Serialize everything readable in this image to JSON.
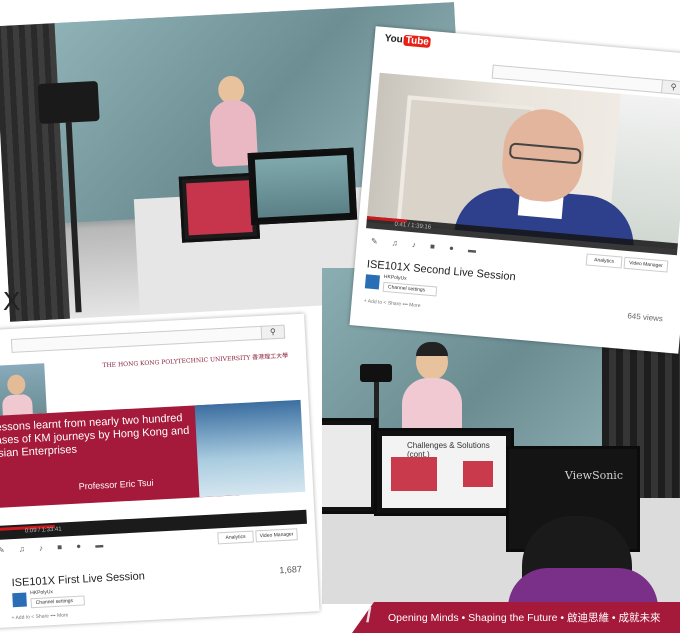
{
  "stray_text": "X",
  "second_session": {
    "logo_text": "You",
    "logo_badge": "Tube",
    "search_icon": "search-icon",
    "video_time": "0:41 / 1:39:16",
    "btn_analytics": "Analytics",
    "btn_video_manager": "Video Manager",
    "title": "ISE101X Second Live Session",
    "channel": "HKPolyUx",
    "channel_settings": "Channel settings",
    "views": "645 views",
    "actions": "+ Add to     < Share     ••• More"
  },
  "first_session": {
    "search_icon": "search-icon",
    "university_logo": "THE HONG KONG POLYTECHNIC UNIVERSITY 香港理工大學",
    "slide_title": "Lessons learnt from nearly two hundred cases of KM journeys by Hong Kong and Asian Enterprises",
    "slide_presenter": "Professor Eric Tsui",
    "video_time": "0:09 / 1:33:41",
    "btn_analytics": "Analytics",
    "btn_video_manager": "Video Manager",
    "title": "ISE101X First Live Session",
    "views": "1,687",
    "channel": "HKPolyUx",
    "channel_settings": "Channel settings",
    "actions": "+ Add to     < Share     ••• More"
  },
  "studio_monitor": {
    "slide_title": "Challenges & Solutions (cont.)",
    "brand": "ViewSonic"
  },
  "footer": {
    "slogan": "Opening Minds • Shaping the Future • 啟迪思維 • 成就未來",
    "accent_color": "#a5193a"
  }
}
